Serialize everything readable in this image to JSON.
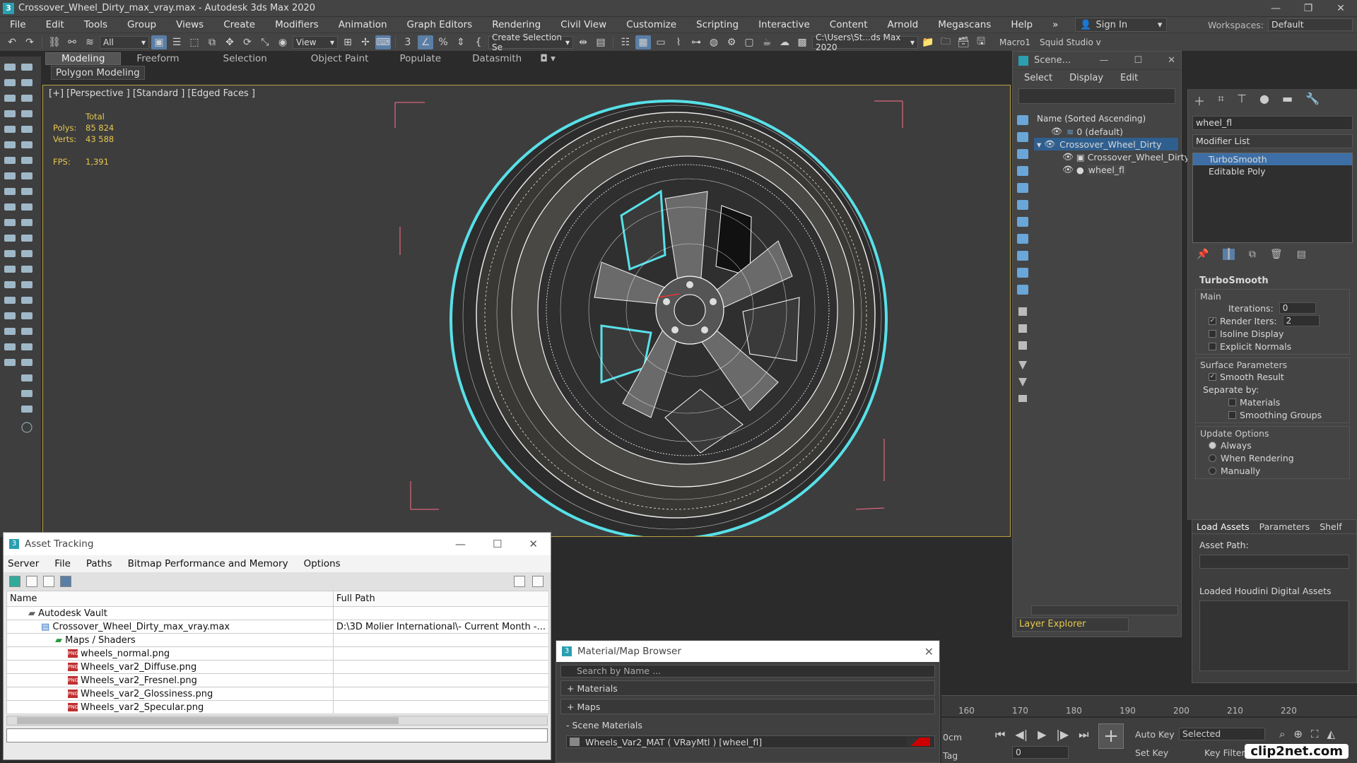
{
  "window": {
    "title": "Crossover_Wheel_Dirty_max_vray.max - Autodesk 3ds Max 2020",
    "controls": [
      "—",
      "❐",
      "✕"
    ]
  },
  "menubar": {
    "items": [
      "File",
      "Edit",
      "Tools",
      "Group",
      "Views",
      "Create",
      "Modifiers",
      "Animation",
      "Graph Editors",
      "Rendering",
      "Civil View",
      "Customize",
      "Scripting",
      "Interactive",
      "Content",
      "Arnold",
      "Megascans",
      "Help"
    ],
    "more": "»",
    "signin": "Sign In",
    "workspaces_label": "Workspaces:",
    "workspace_value": "Default"
  },
  "toolbar": {
    "filter": "All",
    "view": "View",
    "selection_set": "Create Selection Se",
    "path": "C:\\Users\\St...ds Max 2020",
    "macro": "Macro1",
    "squid": "Squid Studio v"
  },
  "ribbon": {
    "tabs": [
      "Modeling",
      "Freeform",
      "Selection",
      "Object Paint",
      "Populate",
      "Datasmith"
    ],
    "subtab": "Polygon Modeling"
  },
  "viewport": {
    "label": "[+] [Perspective ] [Standard ] [Edged Faces ]",
    "total_label": "Total",
    "polys_label": "Polys:",
    "polys": "85 824",
    "verts_label": "Verts:",
    "verts": "43 588",
    "fps_label": "FPS:",
    "fps": "1,391",
    "colors": {
      "selection": "#58e0e8",
      "wire": "#ffffff",
      "bbox": "#ff6f8a",
      "frame": "#b8a040"
    }
  },
  "scene_explorer": {
    "title": "Scene...",
    "menu": [
      "Select",
      "Display",
      "Edit"
    ],
    "column": "Name (Sorted Ascending)",
    "nodes": [
      {
        "label": "0 (default)",
        "indent": 0
      },
      {
        "label": "Crossover_Wheel_Dirty",
        "indent": 0
      },
      {
        "label": "Crossover_Wheel_Dirty",
        "indent": 1
      },
      {
        "label": "wheel_fl",
        "indent": 1
      }
    ],
    "layer_explorer": "Layer Explorer"
  },
  "command_panel": {
    "object_name": "wheel_fl",
    "modifier_list": "Modifier List",
    "stack": [
      "TurboSmooth",
      "Editable Poly"
    ],
    "rollout": "TurboSmooth",
    "main": "Main",
    "iterations_label": "Iterations:",
    "iterations": "0",
    "render_iters_label": "Render Iters:",
    "render_iters": "2",
    "isoline": "Isoline Display",
    "explicit": "Explicit Normals",
    "surface_params": "Surface Parameters",
    "smooth_result": "Smooth Result",
    "separate_by": "Separate by:",
    "materials": "Materials",
    "smoothing_groups": "Smoothing Groups",
    "update_options": "Update Options",
    "always": "Always",
    "when_rendering": "When Rendering",
    "manually": "Manually"
  },
  "houdini": {
    "tabs": [
      "Load Assets",
      "Parameters",
      "Shelf"
    ],
    "asset_path": "Asset Path:",
    "loaded": "Loaded Houdini Digital Assets"
  },
  "asset_tracking": {
    "title": "Asset Tracking",
    "menu": [
      "Server",
      "File",
      "Paths",
      "Bitmap Performance and Memory",
      "Options"
    ],
    "columns": [
      "Name",
      "Full Path"
    ],
    "rows": [
      {
        "name": "Autodesk Vault",
        "path": ""
      },
      {
        "name": "Crossover_Wheel_Dirty_max_vray.max",
        "path": "D:\\3D Molier International\\- Current Month -..."
      },
      {
        "name": "Maps / Shaders",
        "path": ""
      },
      {
        "name": "wheels_normal.png",
        "path": ""
      },
      {
        "name": "Wheels_var2_Diffuse.png",
        "path": ""
      },
      {
        "name": "Wheels_var2_Fresnel.png",
        "path": ""
      },
      {
        "name": "Wheels_var2_Glossiness.png",
        "path": ""
      },
      {
        "name": "Wheels_var2_Specular.png",
        "path": ""
      }
    ]
  },
  "material_browser": {
    "title": "Material/Map Browser",
    "search_placeholder": "Search by Name ...",
    "categories": [
      "+ Materials",
      "+ Maps",
      "- Scene Materials"
    ],
    "material": "Wheels_Var2_MAT ( VRayMtl ) [wheel_fl]"
  },
  "timeline": {
    "ticks": [
      "160",
      "170",
      "180",
      "190",
      "200",
      "210",
      "220"
    ],
    "auto_key": "Auto Key",
    "set_key": "Set Key",
    "selected": "Selected",
    "key_filters": "Key Filters...",
    "frame": "0",
    "unit": "0cm",
    "tag": "Tag"
  },
  "watermark": "clip2net.com"
}
